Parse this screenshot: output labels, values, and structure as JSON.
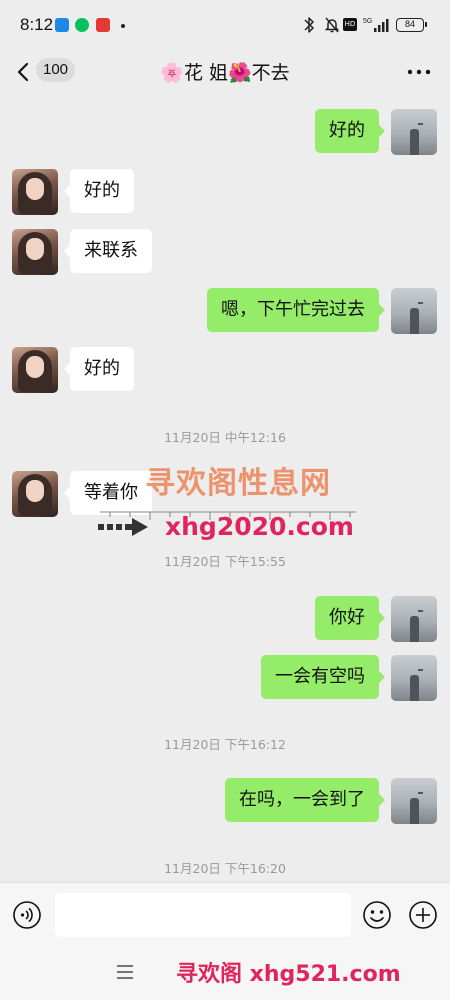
{
  "status_bar": {
    "time": "8:12",
    "battery": "84",
    "network_label": "5G",
    "hd_label": "HD"
  },
  "header": {
    "unread_count": "100",
    "chat_title": "🌸花 姐🌺不去",
    "back_icon": "chevron-left-icon",
    "more_icon": "ellipsis-icon"
  },
  "messages": [
    {
      "sender": "self",
      "text": "好的"
    },
    {
      "sender": "other",
      "text": "好的"
    },
    {
      "sender": "other",
      "text": "来联系"
    },
    {
      "sender": "self",
      "text": "嗯，下午忙完过去"
    },
    {
      "sender": "other",
      "text": "好的"
    },
    {
      "type": "timestamp",
      "text": "11月20日 中午12:16"
    },
    {
      "sender": "other",
      "text": "等着你"
    },
    {
      "type": "timestamp",
      "text": "11月20日 下午15:55"
    },
    {
      "sender": "self",
      "text": "你好"
    },
    {
      "sender": "self",
      "text": "一会有空吗"
    },
    {
      "type": "timestamp",
      "text": "11月20日 下午16:12"
    },
    {
      "sender": "self",
      "text": "在吗，一会到了"
    },
    {
      "type": "timestamp",
      "text": "11月20日 下午16:20"
    }
  ],
  "watermarks": {
    "line1": "寻欢阁性息网",
    "line2": "xhg2020.com",
    "footer": "寻欢阁 xhg521.com"
  },
  "input_bar": {
    "value": "",
    "voice_icon": "voice-icon",
    "emoji_icon": "emoji-icon",
    "plus_icon": "plus-icon"
  },
  "colors": {
    "background": "#ededed",
    "self_bubble": "#95ec69",
    "other_bubble": "#ffffff",
    "timestamp_text": "#9a9a9a",
    "watermark_red": "#e0245e",
    "watermark_orange": "#ec703c"
  }
}
